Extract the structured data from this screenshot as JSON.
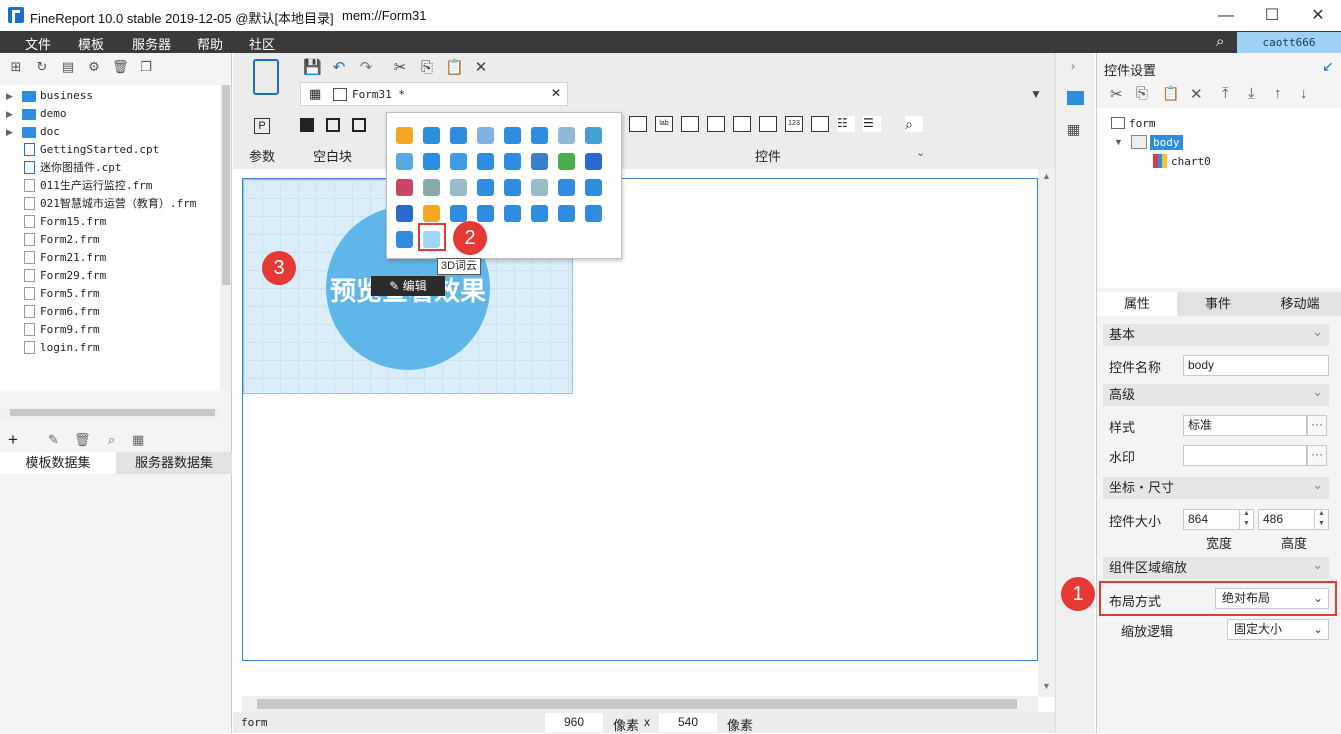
{
  "window": {
    "title": "FineReport 10.0 stable 2019-12-05 @默认[本地目录]",
    "path": "mem://Form31"
  },
  "menu": [
    "文件",
    "模板",
    "服务器",
    "帮助",
    "社区"
  ],
  "user": "caott666",
  "files": [
    {
      "type": "folder",
      "name": "business"
    },
    {
      "type": "folder",
      "name": "demo"
    },
    {
      "type": "folder",
      "name": "doc"
    },
    {
      "type": "cpt",
      "name": "GettingStarted.cpt"
    },
    {
      "type": "cpt",
      "name": "迷你图插件.cpt"
    },
    {
      "type": "frm",
      "name": "011生产运行监控.frm"
    },
    {
      "type": "frm",
      "name": "021智慧城市运营（教育）.frm"
    },
    {
      "type": "frm",
      "name": "Form15.frm"
    },
    {
      "type": "frm",
      "name": "Form2.frm"
    },
    {
      "type": "frm",
      "name": "Form21.frm"
    },
    {
      "type": "frm",
      "name": "Form29.frm"
    },
    {
      "type": "frm",
      "name": "Form5.frm"
    },
    {
      "type": "frm",
      "name": "Form6.frm"
    },
    {
      "type": "frm",
      "name": "Form9.frm"
    },
    {
      "type": "frm",
      "name": "login.frm"
    }
  ],
  "dataset_tabs": {
    "template": "模板数据集",
    "server": "服务器数据集"
  },
  "editor_tab": "Form31 *",
  "toolbar_labels": {
    "param": "参数",
    "blank": "空白块",
    "widget": "控件"
  },
  "chart_preview": {
    "text": "预览查看效果",
    "edit": "编辑"
  },
  "tooltip": "3D词云",
  "steps": [
    "1",
    "2",
    "3"
  ],
  "status": {
    "selected": "form",
    "width": "960",
    "height": "540",
    "unit": "像素",
    "x": "x"
  },
  "right": {
    "header": "控件设置",
    "tree": {
      "root": "form",
      "body": "body",
      "chart": "chart0"
    },
    "tabs": [
      "属性",
      "事件",
      "移动端"
    ],
    "sections": {
      "basic": "基本",
      "advanced": "高级",
      "coords": "坐标・尺寸",
      "zoom": "组件区域缩放"
    },
    "fields": {
      "name_label": "控件名称",
      "name_value": "body",
      "style_label": "样式",
      "style_value": "标准",
      "watermark_label": "水印",
      "watermark_value": "",
      "size_label": "控件大小",
      "width_value": "864",
      "height_value": "486",
      "width_caption": "宽度",
      "height_caption": "高度",
      "layout_label": "布局方式",
      "layout_value": "绝对布局",
      "scale_label": "缩放逻辑",
      "scale_value": "固定大小"
    }
  },
  "colors": {
    "accent": "#1a6fc7",
    "highlight": "#e53935",
    "menubar": "#3a3a3a"
  }
}
